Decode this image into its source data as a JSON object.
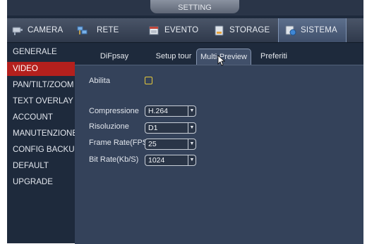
{
  "window": {
    "title": "SETTING"
  },
  "topnav": {
    "items": [
      {
        "label": "CAMERA",
        "icon": "camera-icon"
      },
      {
        "label": "RETE",
        "icon": "network-icon"
      },
      {
        "label": "EVENTO",
        "icon": "event-icon"
      },
      {
        "label": "STORAGE",
        "icon": "storage-icon"
      },
      {
        "label": "SISTEMA",
        "icon": "system-icon",
        "active": true
      }
    ]
  },
  "sidebar": {
    "items": [
      {
        "label": "GENERALE"
      },
      {
        "label": "VIDEO",
        "active": true
      },
      {
        "label": "PAN/TILT/ZOOM"
      },
      {
        "label": "TEXT OVERLAY"
      },
      {
        "label": "ACCOUNT"
      },
      {
        "label": "MANUTENZIONE"
      },
      {
        "label": "CONFIG BACKUF"
      },
      {
        "label": "DEFAULT"
      },
      {
        "label": "UPGRADE"
      }
    ]
  },
  "subtabs": [
    {
      "label": "DiFpsay"
    },
    {
      "label": "Setup tour"
    },
    {
      "label": "Multi-Preview",
      "active": true
    },
    {
      "label": "Preferiti"
    }
  ],
  "form": {
    "enable_label": "Abilita",
    "enable_checked": false,
    "compression": {
      "label": "Compressione",
      "value": "H.264"
    },
    "resolution": {
      "label": "Risoluzione",
      "value": "D1"
    },
    "frame_rate": {
      "label": "Frame Rate(FPS)",
      "value": "25"
    },
    "bit_rate": {
      "label": "Bit Rate(Kb/S)",
      "value": "1024"
    }
  },
  "colors": {
    "active_sidebar": "#b4201d",
    "checkbox_border": "#e6c93a",
    "panel_bg": "#34425a"
  }
}
